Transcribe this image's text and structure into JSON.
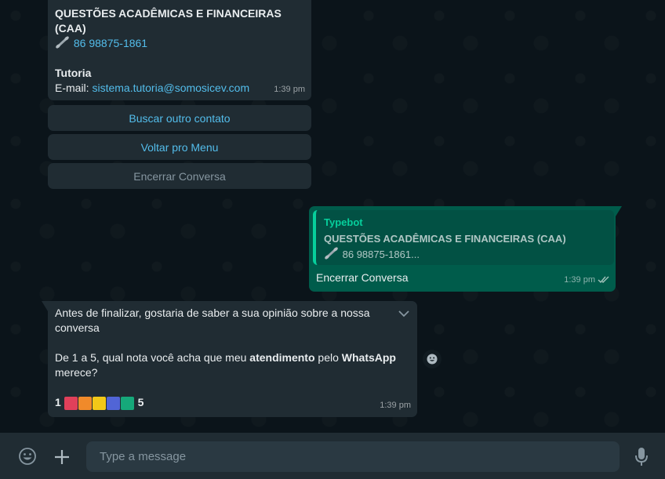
{
  "messages": {
    "contacts": {
      "dept_title_line1": "QUESTÕES ACADÊMICAS E FINANCEIRAS",
      "dept_title_line2": "(CAA)",
      "phone_icon": "telephone-receiver-icon",
      "phone": "86 98875-1861",
      "tutoria_label": "Tutoria",
      "email_prefix": "E-mail: ",
      "email": "sistema.tutoria@somosicev.com",
      "time": "1:39 pm"
    },
    "buttons": [
      {
        "label": "Buscar outro contato"
      },
      {
        "label": "Voltar pro Menu"
      },
      {
        "label": "Encerrar Conversa"
      }
    ],
    "reply": {
      "quote_author": "Typebot",
      "quote_title": "QUESTÕES ACADÊMICAS E FINANCEIRAS (CAA)",
      "quote_phone": "86 98875-1861...",
      "text": "Encerrar Conversa",
      "time": "1:39 pm",
      "status_icon": "double-check-icon"
    },
    "survey": {
      "line1": "Antes de finalizar, gostaria de saber a sua opinião sobre a nossa",
      "line2": "conversa",
      "q_prefix": "De 1 a 5, qual nota você acha que meu ",
      "q_bold1": "atendimento",
      "q_mid": " pelo ",
      "q_bold2": "WhatsApp",
      "q_line2": "merece?",
      "scale_min": "1",
      "scale_max": "5",
      "scale_colors": [
        "#e0405a",
        "#f08a2a",
        "#f2c818",
        "#5165d6",
        "#16a87a"
      ],
      "time": "1:39 pm"
    }
  },
  "composer": {
    "placeholder": "Type a message",
    "emoji_icon": "emoji-icon",
    "attach_icon": "plus-icon",
    "mic_icon": "microphone-icon"
  },
  "colors": {
    "bubble_in": "#202c33",
    "bubble_out": "#005c4b",
    "link": "#53bdeb",
    "accent": "#06cf9c"
  }
}
